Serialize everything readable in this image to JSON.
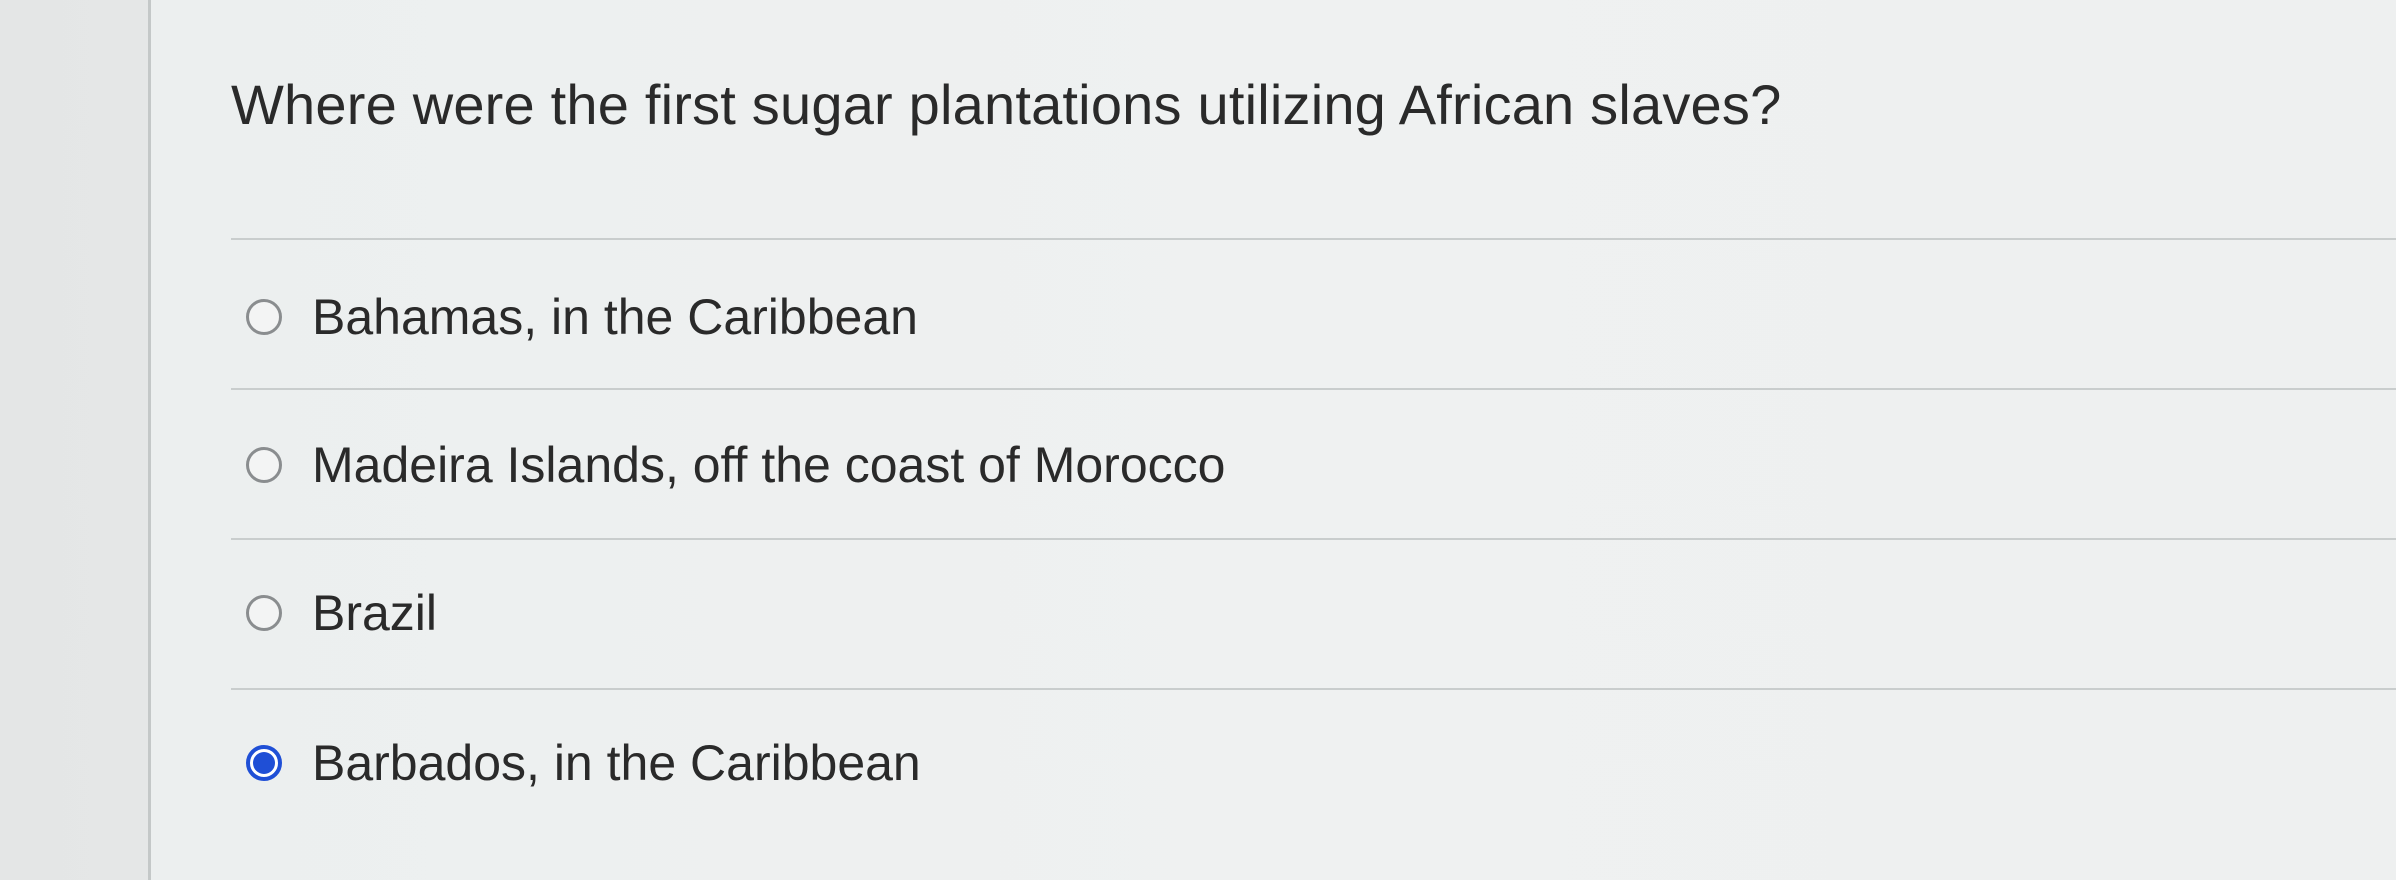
{
  "question": {
    "text": "Where were the first sugar plantations utilizing African slaves?"
  },
  "options": [
    {
      "label": "Bahamas, in the Caribbean",
      "selected": false
    },
    {
      "label": "Madeira Islands, off the coast of Morocco",
      "selected": false
    },
    {
      "label": "Brazil",
      "selected": false
    },
    {
      "label": "Barbados, in the Caribbean",
      "selected": true
    }
  ],
  "colors": {
    "radio_selected": "#1f4fd6",
    "radio_unselected_border": "#8a8d8f",
    "text": "#2a2a2a"
  }
}
